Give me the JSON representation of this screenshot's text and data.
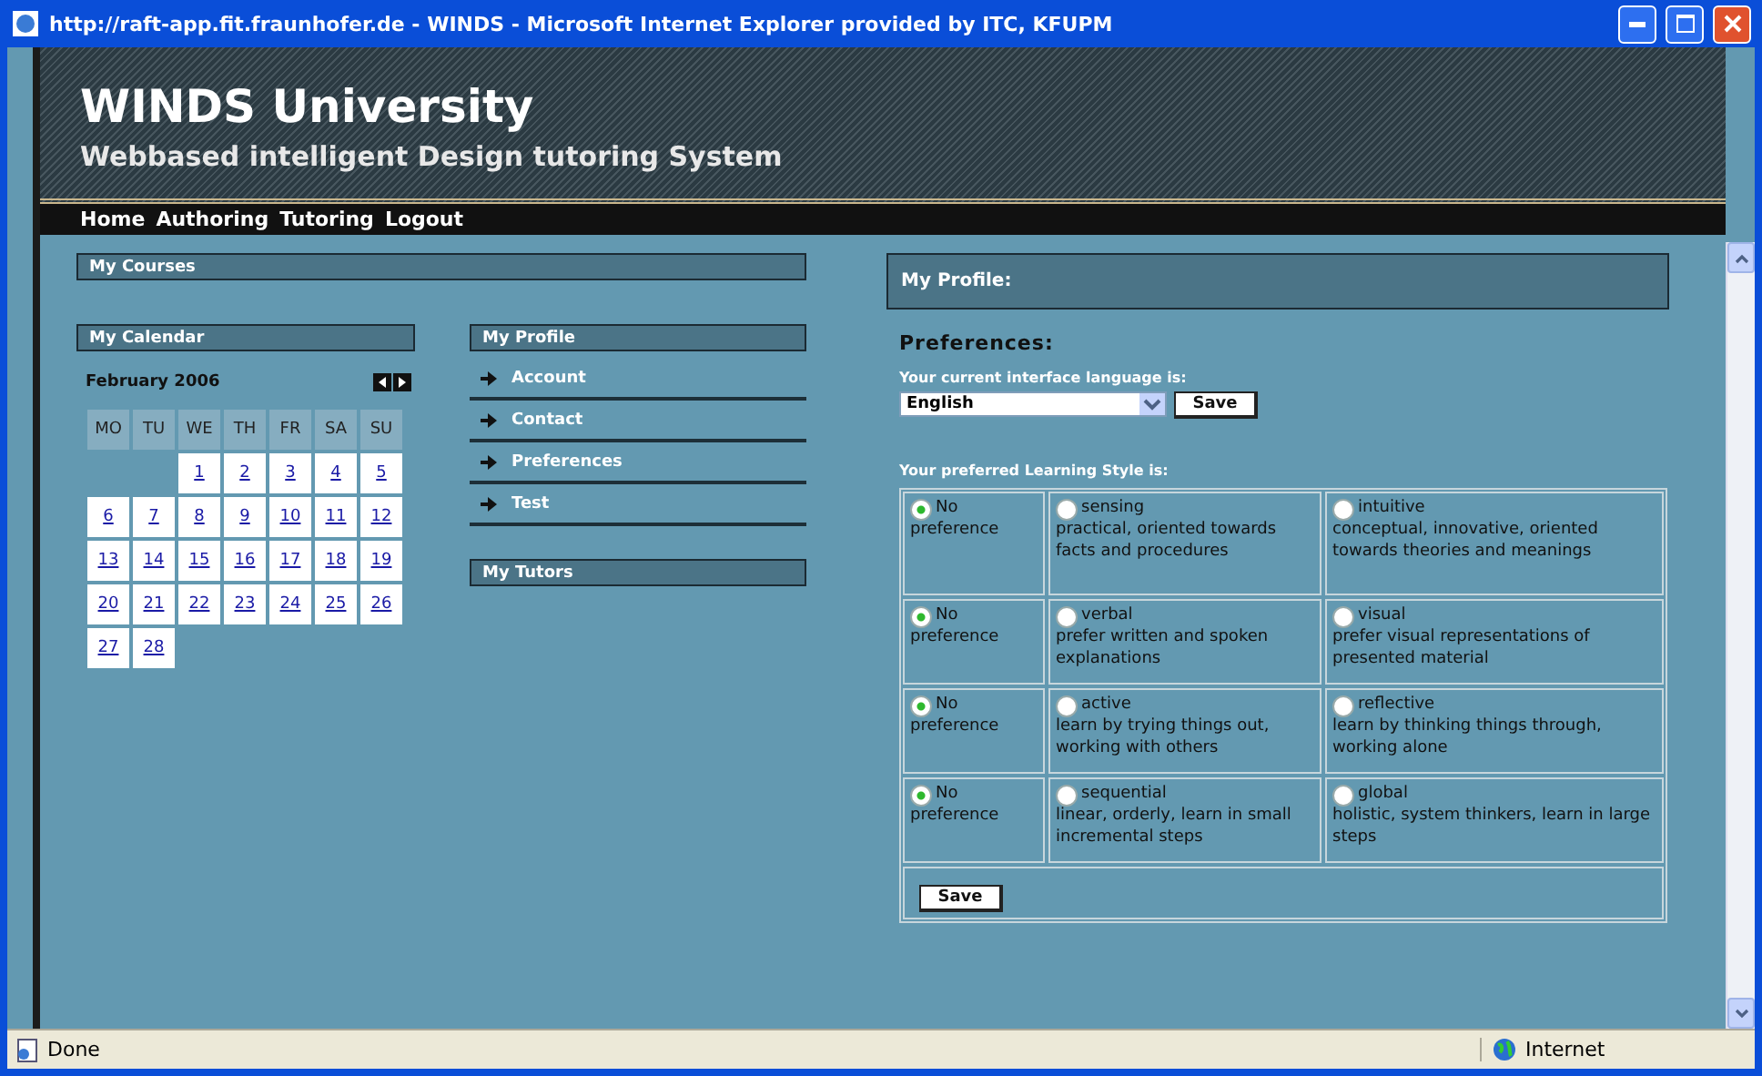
{
  "window": {
    "title": "http://raft-app.fit.fraunhofer.de - WINDS - Microsoft Internet Explorer provided by ITC, KFUPM"
  },
  "header": {
    "title": "WINDS University",
    "subtitle": "Webbased intelligent Design tutoring System"
  },
  "nav": [
    "Home",
    "Authoring",
    "Tutoring",
    "Logout"
  ],
  "my_courses": {
    "title": "My Courses"
  },
  "calendar": {
    "title": "My Calendar",
    "month": "February 2006",
    "weekdays": [
      "MO",
      "TU",
      "WE",
      "TH",
      "FR",
      "SA",
      "SU"
    ],
    "weeks": [
      {
        "days": [
          {
            "blank": true
          },
          {
            "blank": true
          },
          {
            "label": "1",
            "blank": false
          },
          {
            "label": "2",
            "blank": false
          },
          {
            "label": "3",
            "blank": false
          },
          {
            "label": "4",
            "blank": false
          },
          {
            "label": "5",
            "blank": false
          }
        ]
      },
      {
        "days": [
          {
            "label": "6",
            "blank": false
          },
          {
            "label": "7",
            "blank": false
          },
          {
            "label": "8",
            "blank": false
          },
          {
            "label": "9",
            "blank": false
          },
          {
            "label": "10",
            "blank": false
          },
          {
            "label": "11",
            "blank": false
          },
          {
            "label": "12",
            "blank": false
          }
        ]
      },
      {
        "days": [
          {
            "label": "13",
            "blank": false
          },
          {
            "label": "14",
            "blank": false
          },
          {
            "label": "15",
            "blank": false
          },
          {
            "label": "16",
            "blank": false
          },
          {
            "label": "17",
            "blank": false
          },
          {
            "label": "18",
            "blank": false
          },
          {
            "label": "19",
            "blank": false
          }
        ]
      },
      {
        "days": [
          {
            "label": "20",
            "blank": false
          },
          {
            "label": "21",
            "blank": false
          },
          {
            "label": "22",
            "blank": false
          },
          {
            "label": "23",
            "blank": false
          },
          {
            "label": "24",
            "blank": false
          },
          {
            "label": "25",
            "blank": false
          },
          {
            "label": "26",
            "blank": false
          }
        ]
      },
      {
        "days": [
          {
            "label": "27",
            "blank": false
          },
          {
            "label": "28",
            "blank": false
          }
        ]
      }
    ]
  },
  "profile_menu": {
    "title": "My Profile",
    "items": [
      "Account",
      "Contact",
      "Preferences",
      "Test"
    ]
  },
  "tutors": {
    "title": "My Tutors"
  },
  "profile": {
    "title": "My Profile:",
    "section": "Preferences:",
    "language_label": "Your current interface language is:",
    "language": "English",
    "language_save": "Save",
    "style_label": "Your preferred Learning Style is:",
    "rows": [
      {
        "options": [
          {
            "label": "No",
            "description": "preference",
            "selected": true
          },
          {
            "label": "sensing",
            "description": "practical, oriented towards facts and procedures",
            "selected": false
          },
          {
            "label": "intuitive",
            "description": "conceptual, innovative, oriented towards theories and meanings",
            "selected": false
          }
        ]
      },
      {
        "options": [
          {
            "label": "No",
            "description": "preference",
            "selected": true
          },
          {
            "label": "verbal",
            "description": "prefer written and spoken explanations",
            "selected": false
          },
          {
            "label": "visual",
            "description": "prefer visual representations of presented material",
            "selected": false
          }
        ]
      },
      {
        "options": [
          {
            "label": "No",
            "description": "preference",
            "selected": true
          },
          {
            "label": "active",
            "description": "learn by trying things out, working with others",
            "selected": false
          },
          {
            "label": "reflective",
            "description": "learn by thinking things through, working alone",
            "selected": false
          }
        ]
      },
      {
        "options": [
          {
            "label": "No",
            "description": "preference",
            "selected": true
          },
          {
            "label": "sequential",
            "description": "linear, orderly, learn in small incremental steps",
            "selected": false
          },
          {
            "label": "global",
            "description": "holistic, system thinkers, learn in large steps",
            "selected": false
          }
        ]
      }
    ],
    "save": "Save"
  },
  "status_bar": {
    "text": "Done",
    "zone": "Internet"
  }
}
